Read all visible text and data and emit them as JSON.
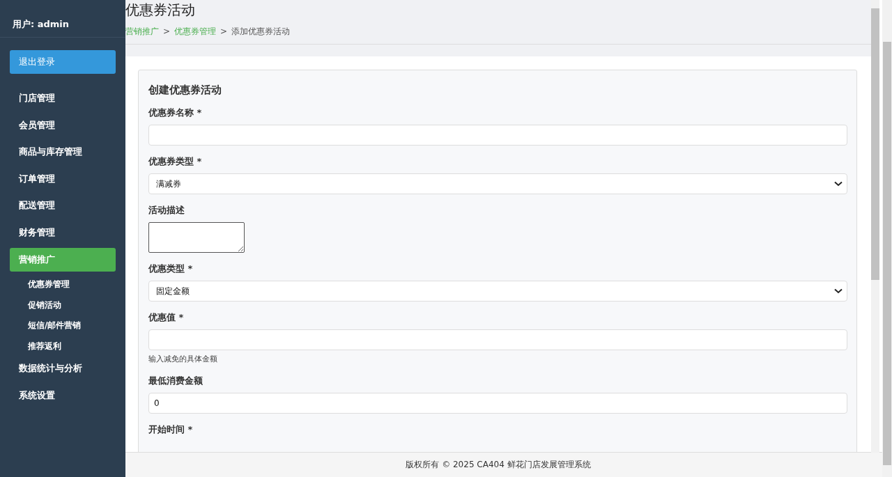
{
  "sidebar": {
    "user": "用户: admin",
    "logout": "退出登录",
    "items": [
      {
        "label": "门店管理",
        "selected": false
      },
      {
        "label": "会员管理",
        "selected": false
      },
      {
        "label": "商品与库存管理",
        "selected": false
      },
      {
        "label": "订单管理",
        "selected": false
      },
      {
        "label": "配送管理",
        "selected": false
      },
      {
        "label": "财务管理",
        "selected": false
      },
      {
        "label": "营销推广",
        "selected": true,
        "children": [
          {
            "label": "优惠券管理"
          },
          {
            "label": "促销活动"
          },
          {
            "label": "短信/邮件营销"
          },
          {
            "label": "推荐返利"
          }
        ]
      },
      {
        "label": "数据统计与分析",
        "selected": false
      },
      {
        "label": "系统设置",
        "selected": false
      }
    ]
  },
  "page": {
    "title": "优惠券活动",
    "breadcrumb": [
      {
        "label": "营销推广",
        "link": true
      },
      {
        "label": "优惠券管理",
        "link": true
      },
      {
        "label": "添加优惠券活动",
        "link": false
      }
    ],
    "separator": ">"
  },
  "form": {
    "title": "创建优惠券活动",
    "fields": [
      {
        "label": "优惠券名称 *",
        "kind": "text"
      },
      {
        "label": "优惠券类型 *",
        "kind": "select",
        "value": "满减券"
      },
      {
        "label": "活动描述",
        "kind": "textarea"
      },
      {
        "label": "优惠类型 *",
        "kind": "select",
        "value": "固定金额"
      },
      {
        "label": "优惠值 *",
        "kind": "text",
        "hint": "输入减免的具体金额"
      },
      {
        "label": "最低消费金额",
        "kind": "text",
        "value": "0"
      },
      {
        "label": "开始时间 *"
      }
    ]
  },
  "footer": "版权所有 © 2025 CA404 鲜花门店发展管理系统"
}
